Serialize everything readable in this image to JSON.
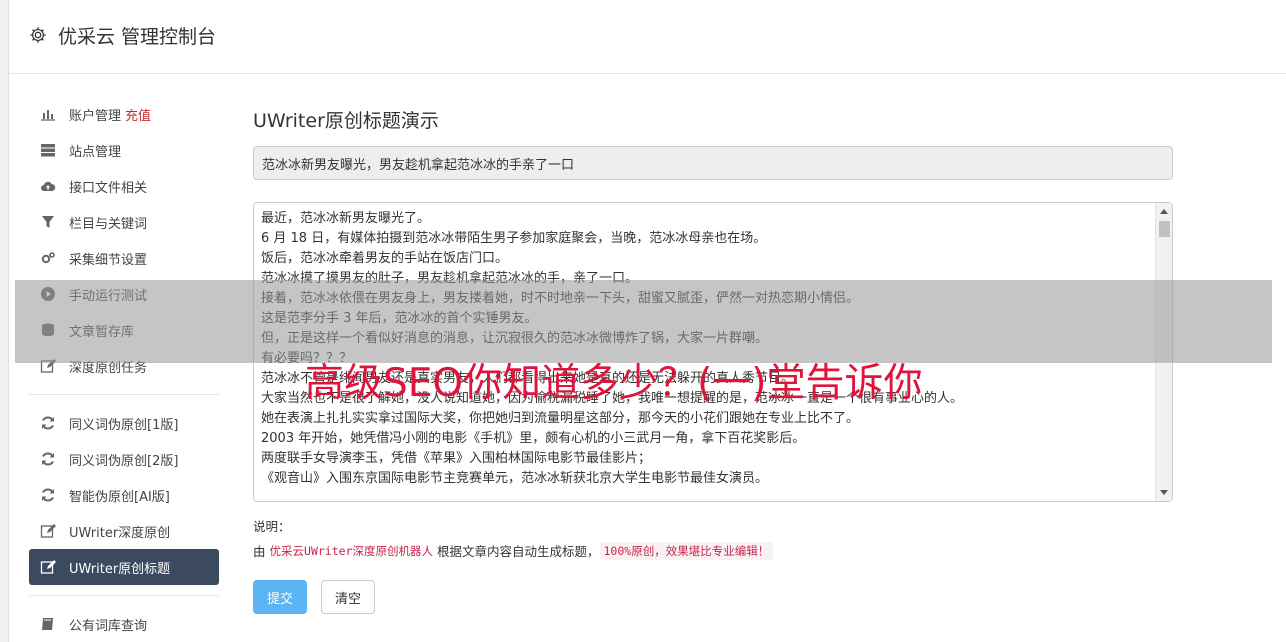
{
  "app": {
    "title": "优采云 管理控制台",
    "brand_icon": "gear-icon"
  },
  "sidebar": {
    "items": [
      {
        "label": "账户管理",
        "badge": "充值",
        "icon": "bar-chart-icon"
      },
      {
        "label": "站点管理",
        "icon": "server-icon"
      },
      {
        "label": "接口文件相关",
        "icon": "cloud-upload-icon"
      },
      {
        "label": "栏目与关键词",
        "icon": "filter-icon"
      },
      {
        "label": "采集细节设置",
        "icon": "cogs-icon"
      },
      {
        "label": "手动运行测试",
        "icon": "play-circle-icon"
      },
      {
        "label": "文章暂存库",
        "icon": "database-icon"
      },
      {
        "label": "深度原创任务",
        "icon": "edit-icon"
      }
    ],
    "items2": [
      {
        "label": "同义词伪原创[1版]",
        "icon": "refresh-icon"
      },
      {
        "label": "同义词伪原创[2版]",
        "icon": "refresh-icon"
      },
      {
        "label": "智能伪原创[AI版]",
        "icon": "refresh-icon"
      },
      {
        "label": "UWriter深度原创",
        "icon": "edit-icon"
      },
      {
        "label": "UWriter原创标题",
        "icon": "edit-icon",
        "active": true
      }
    ],
    "items3": [
      {
        "label": "公有词库查询",
        "icon": "book-icon"
      }
    ]
  },
  "main": {
    "page_title": "UWriter原创标题演示",
    "title_value": "范冰冰新男友曝光，男友趁机拿起范冰冰的手亲了一口",
    "article_lines": [
      "最近，范冰冰新男友曝光了。",
      "6 月 18 日，有媒体拍摄到范冰冰带陌生男子参加家庭聚会，当晚，范冰冰母亲也在场。",
      "饭后，范冰冰牵着男友的手站在饭店门口。",
      "范冰冰摸了摸男友的肚子，男友趁机拿起范冰冰的手，亲了一口。",
      "接着，范冰冰依偎在男友身上，男友搂着她，时不时地亲一下头，甜蜜又腻歪，俨然一对热恋期小情侣。",
      "这是范李分手 3 年后，范冰冰的首个实锤男友。",
      "但，正是这样一个看似好消息的消息，让沉寂很久的范冰冰微博炸了锅，大家一片群嘲。",
      "有必要吗？？？",
      "范冰冰不管是绯闻男友还是真实男友，人们都看得出来她是真的还是无法躲开的真人秀节目。",
      "大家当然也不是很了解她，没人说知道她，因为偷税漏税睡了她，我唯一想提醒的是，范冰冰一直是一个很有事业心的人。",
      "她在表演上扎扎实实拿过国际大奖，你把她归到流量明星这部分，那今天的小花们跟她在专业上比不了。",
      "2003 年开始，她凭借冯小刚的电影《手机》里，颇有心机的小三武月一角，拿下百花奖影后。",
      "两度联手女导演李玉，凭借《苹果》入围柏林国际电影节最佳影片；",
      "《观音山》入围东京国际电影节主竞赛单元，范冰冰斩获北京大学生电影节最佳女演员。"
    ],
    "note_label": "说明：",
    "note_prefix": "由",
    "note_code1": "优采云UWriter深度原创机器人",
    "note_middle": "根据文章内容自动生成标题，",
    "note_code2": "100%原创，效果堪比专业编辑！",
    "submit_label": "提交",
    "clear_label": "清空"
  },
  "watermark": {
    "text": "高级SEO你知道多少？(一)堂告诉你",
    "color": "#e0133a"
  },
  "colors": {
    "active_nav_bg": "#3b4a5e",
    "primary_button": "#5bb4f4",
    "recharge_red": "#c9302c"
  }
}
